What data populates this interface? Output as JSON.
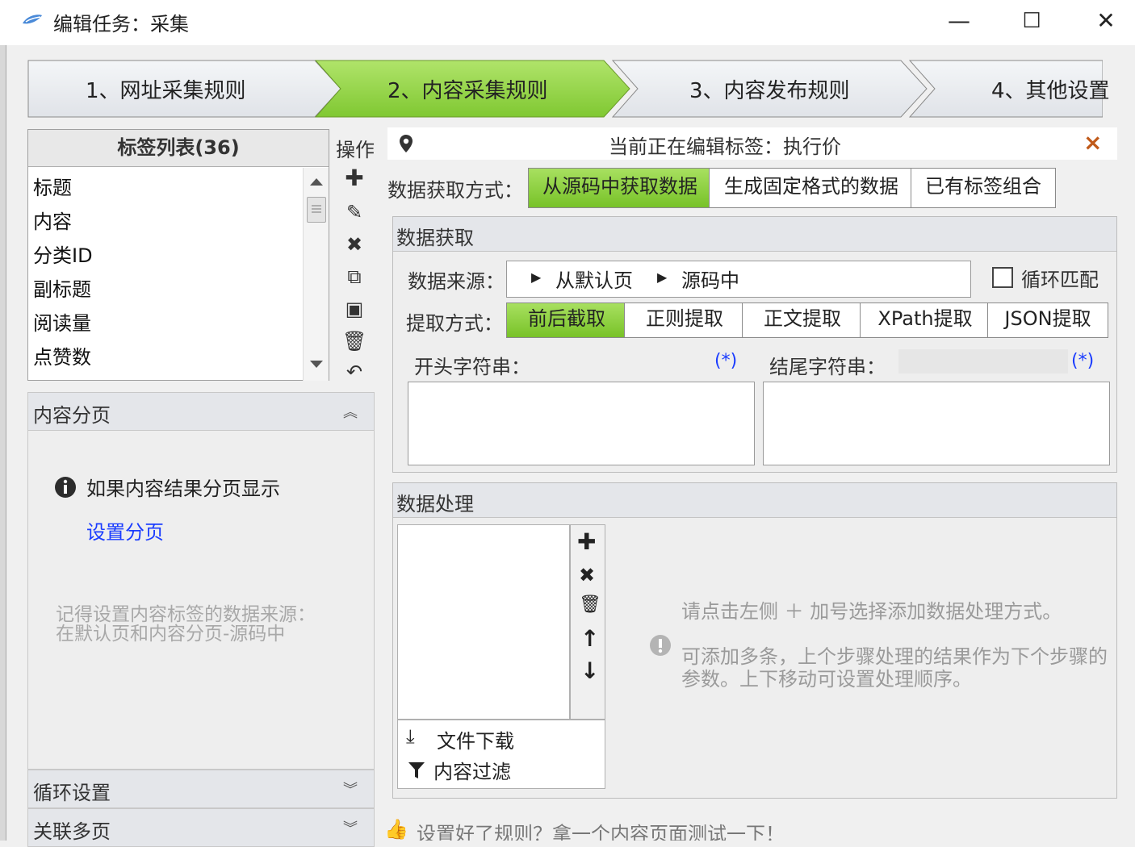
{
  "window": {
    "title": "编辑任务：采集",
    "minimize": "—",
    "maximize": "☐",
    "close": "✕"
  },
  "steps": [
    {
      "label": "1、网址采集规则",
      "active": false
    },
    {
      "label": "2、内容采集规则",
      "active": true
    },
    {
      "label": "3、内容发布规则",
      "active": false
    },
    {
      "label": "4、其他设置",
      "active": false
    }
  ],
  "tag_list": {
    "title": "标签列表(36)",
    "items": [
      "标题",
      "内容",
      "分类ID",
      "副标题",
      "阅读量",
      "点赞数"
    ]
  },
  "ops": {
    "title": "操作",
    "icons": [
      "plus-icon",
      "edit-icon",
      "delete-icon",
      "copy-icon",
      "paste-icon",
      "trash-icon",
      "undo-icon"
    ]
  },
  "accordion": {
    "content_paging": "内容分页",
    "info_text": "如果内容结果分页显示",
    "set_paging_link": "设置分页",
    "note_line1": "记得设置内容标签的数据来源：",
    "note_line2": "在默认页和内容分页-源码中",
    "loop_settings": "循环设置",
    "related_pages": "关联多页"
  },
  "editor": {
    "editing_label": "当前正在编辑标签：执行价",
    "close": "×",
    "method_label": "数据获取方式：",
    "methods": [
      {
        "label": "从源码中获取数据",
        "active": true
      },
      {
        "label": "生成固定格式的数据",
        "active": false
      },
      {
        "label": "已有标签组合",
        "active": false
      }
    ]
  },
  "data_fetch": {
    "title": "数据获取",
    "source_label": "数据来源：",
    "source_part1": "从默认页",
    "source_part2": "源码中",
    "loop_match": "循环匹配",
    "extract_label": "提取方式：",
    "extract_modes": [
      {
        "label": "前后截取",
        "active": true
      },
      {
        "label": "正则提取",
        "active": false
      },
      {
        "label": "正文提取",
        "active": false
      },
      {
        "label": "XPath提取",
        "active": false
      },
      {
        "label": "JSON提取",
        "active": false
      }
    ],
    "start_label": "开头字符串：",
    "end_label": "结尾字符串：",
    "wildcard": "(*)"
  },
  "data_process": {
    "title": "数据处理",
    "menu_items": [
      {
        "icon": "download-icon",
        "label": "文件下载"
      },
      {
        "icon": "filter-icon",
        "label": "内容过滤"
      }
    ],
    "hint1": "请点击左侧 ＋ 加号选择添加数据处理方式。",
    "hint2_line1": "可添加多条，上个步骤处理的结果作为下个步骤的",
    "hint2_line2": "参数。上下移动可设置处理顺序。"
  },
  "footer": {
    "test_hint": "设置好了规则？拿一个内容页面测试一下！"
  },
  "colors": {
    "active_green": "#8fd13c",
    "link_blue": "#1a3cff",
    "accent_orange": "#c05a1a"
  }
}
